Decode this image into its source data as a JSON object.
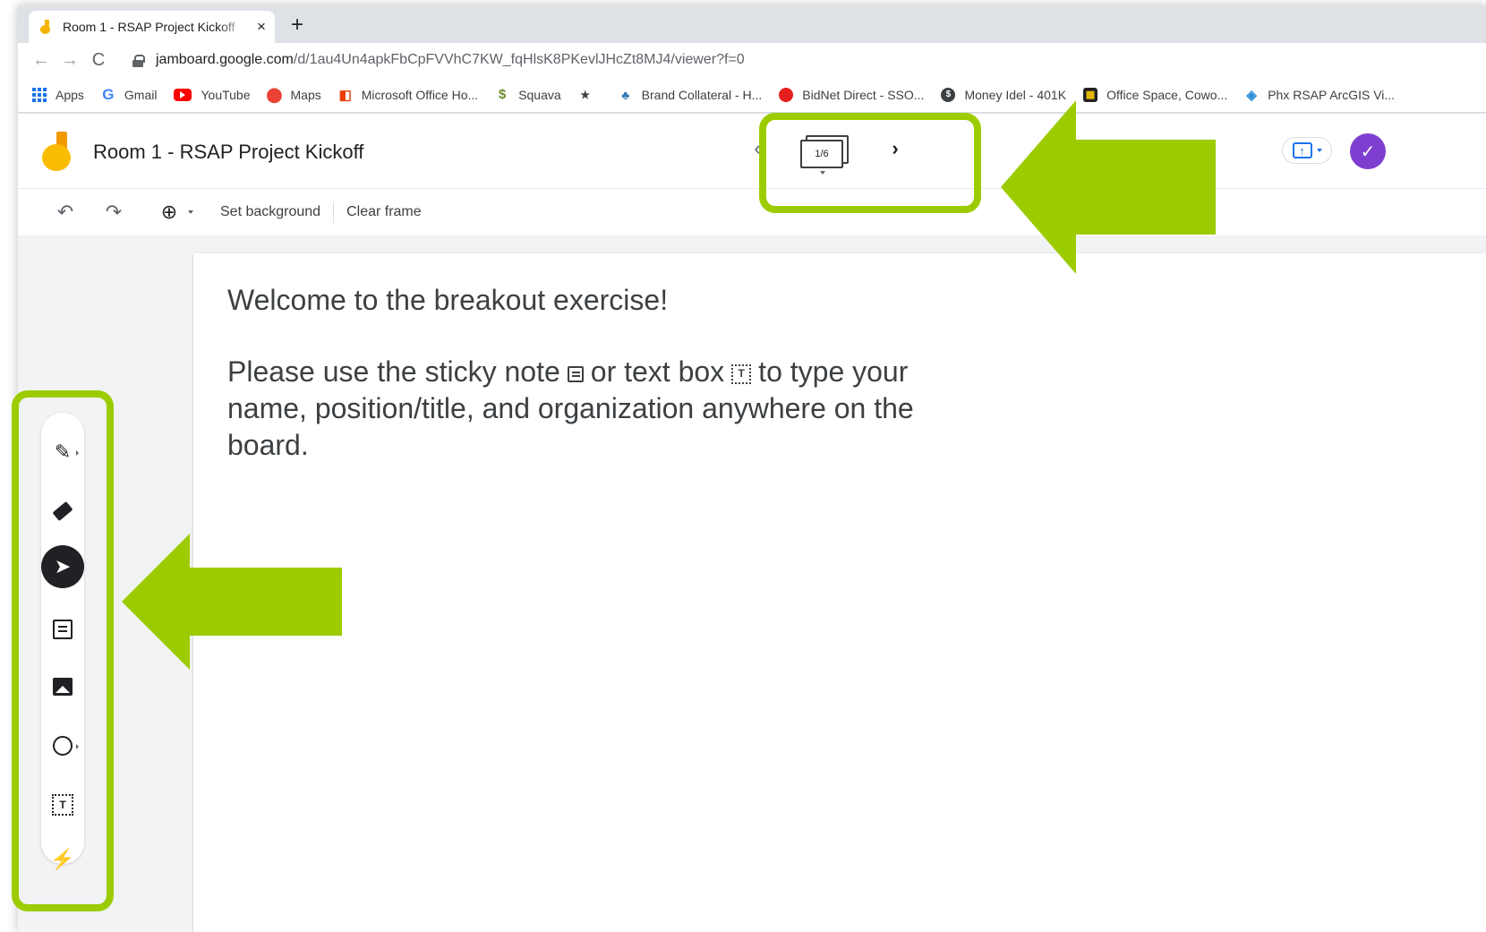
{
  "browser": {
    "tab": {
      "title": "Room 1 - RSAP Project Kickoff",
      "close": "×"
    },
    "new_tab": "+",
    "nav": {
      "back": "←",
      "forward": "→",
      "reload": "C"
    },
    "url": {
      "host": "jamboard.google.com",
      "path": "/d/1au4Un4apkFbCpFVVhC7KW_fqHlsK8PKevlJHcZt8MJ4/viewer?f=0"
    },
    "bookmarks": [
      {
        "label": "Apps",
        "icon": "apps-grid-icon"
      },
      {
        "label": "Gmail",
        "icon": "google-icon",
        "glyph": "G"
      },
      {
        "label": "YouTube",
        "icon": "youtube-icon"
      },
      {
        "label": "Maps",
        "icon": "maps-pin-icon",
        "glyph": "⬤"
      },
      {
        "label": "Microsoft Office Ho...",
        "icon": "office-icon",
        "glyph": "◧"
      },
      {
        "label": "Squava",
        "icon": "squava-icon",
        "glyph": "$"
      },
      {
        "label": "",
        "icon": "bookmark-star-icon",
        "glyph": "★"
      },
      {
        "label": "Brand Collateral - H...",
        "icon": "brand-icon",
        "glyph": "♣"
      },
      {
        "label": "BidNet Direct - SSO...",
        "icon": "bidnet-icon"
      },
      {
        "label": "Money Idel - 401K",
        "icon": "money-icon",
        "glyph": "$"
      },
      {
        "label": "Office Space, Cowo...",
        "icon": "office-space-icon",
        "glyph": "▦"
      },
      {
        "label": "Phx RSAP ArcGIS Vi...",
        "icon": "arcgis-icon",
        "glyph": "◈"
      }
    ]
  },
  "jamboard": {
    "title": "Room 1 - RSAP Project Kickoff",
    "frame_prev": "‹",
    "frame_next": "›",
    "frame_counter": "1/6",
    "avatar_glyph": "✓",
    "share_glyph": "↑",
    "toolbar": {
      "undo": "↶",
      "redo": "↷",
      "zoom": "⊕",
      "set_background": "Set background",
      "clear_frame": "Clear frame"
    },
    "tools": {
      "pen": "✎",
      "select": "➤",
      "textbox": "T",
      "laser": "⚡"
    },
    "canvas": {
      "welcome": "Welcome to the breakout exercise!",
      "line_part1": "Please use the sticky note",
      "line_part2": "or text box",
      "line_part3": "to type your name, position/title, and organization anywhere on the board.",
      "textbox_glyph": "T"
    }
  },
  "colors": {
    "highlight": "#9ccc00",
    "avatar": "#7e3fd1",
    "jamboard_yellow": "#fbbc04"
  }
}
